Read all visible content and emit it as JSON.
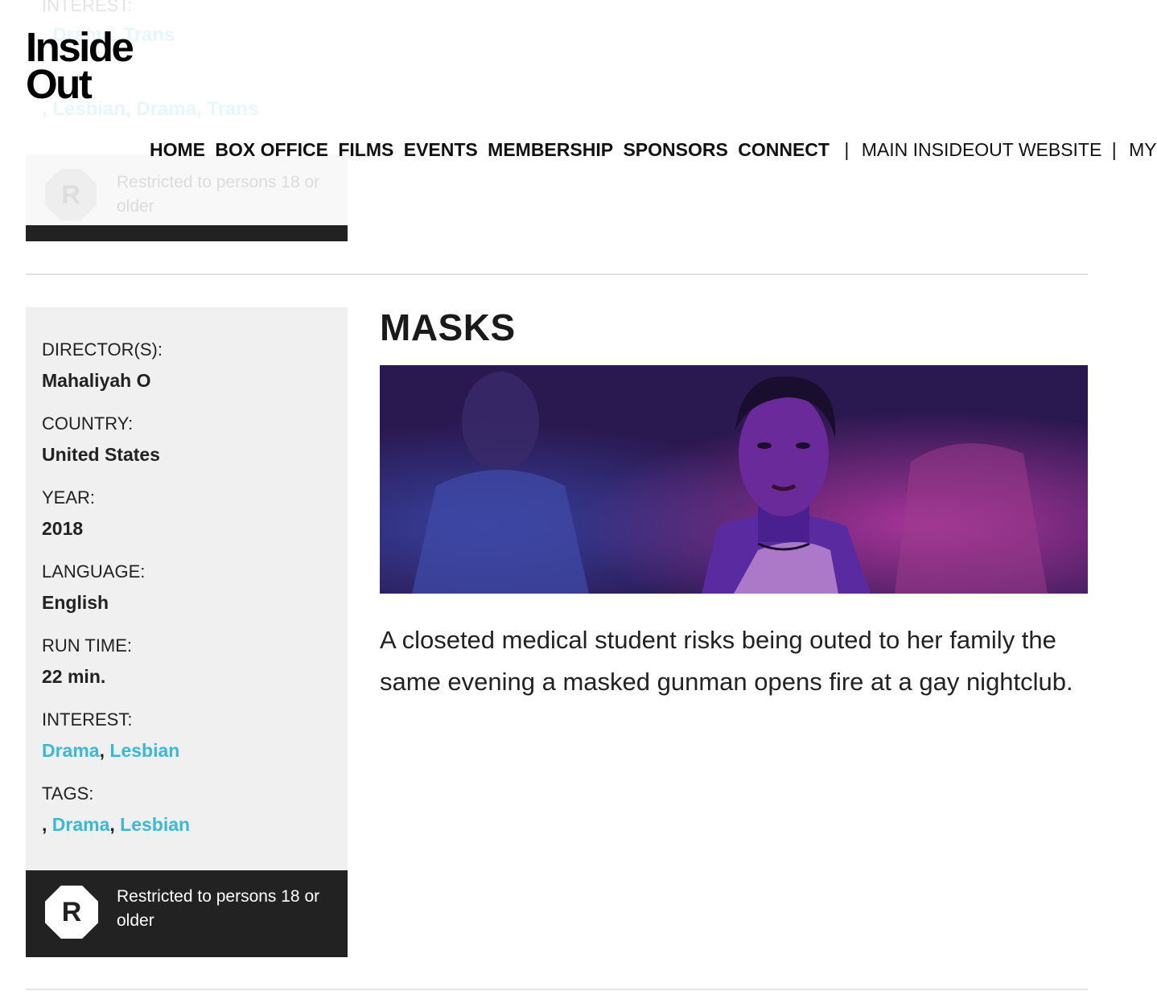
{
  "previous_entry": {
    "interest_label": "INTEREST:",
    "interest_links": ", Drama, Trans",
    "tags_links": ", Lesbian, Drama, Trans",
    "rating_text": "Restricted to persons 18 or older",
    "rating_letter": "R"
  },
  "logo": {
    "line1": "Inside",
    "line2": "Out"
  },
  "nav": {
    "home": "HOME",
    "box_office": "BOX OFFICE",
    "films": "FILMS",
    "events": "EVENTS",
    "membership": "MEMBERSHIP",
    "sponsors": "SPONSORS",
    "connect": "CONNECT",
    "separator": "|",
    "main_site": "MAIN INSIDEOUT WEBSITE",
    "my_f": "MY F"
  },
  "film": {
    "title": "MASKS",
    "description": "A closeted medical student risks being outed to her family the same evening a masked gunman opens fire at a gay nightclub.",
    "director_label": "DIRECTOR(S):",
    "director": "Mahaliyah O",
    "country_label": "COUNTRY:",
    "country": "United States",
    "year_label": "YEAR:",
    "year": "2018",
    "language_label": "LANGUAGE:",
    "language": "English",
    "runtime_label": "RUN TIME:",
    "runtime": "22 min.",
    "interest_label": "INTEREST:",
    "interest": [
      "Drama",
      "Lesbian"
    ],
    "tags_label": "TAGS:",
    "tags_prefix": ",",
    "tags": [
      "Drama",
      "Lesbian"
    ],
    "list_separator": ",",
    "rating_letter": "R",
    "rating_text": "Restricted to persons 18 or older"
  },
  "colors": {
    "link": "#3bb8d6",
    "sidebar_bg": "#f0f0f0",
    "rating_bg": "#222222"
  }
}
